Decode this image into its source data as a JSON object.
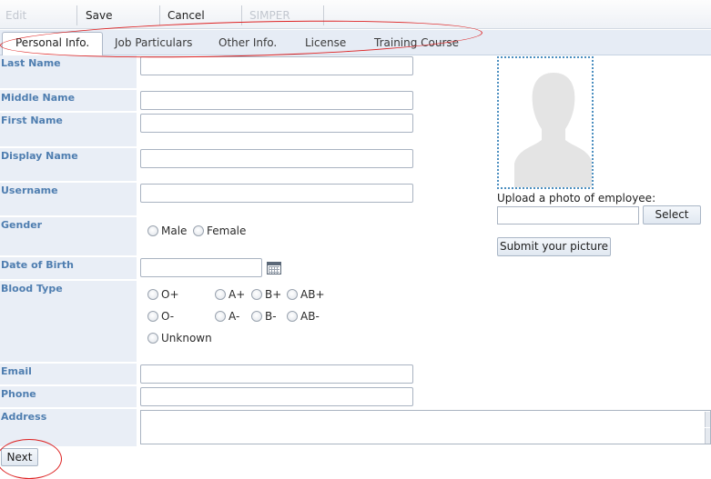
{
  "toolbar": {
    "edit_label": "Edit",
    "save_label": "Save",
    "cancel_label": "Cancel",
    "simper_label": "SIMPER"
  },
  "tabs": [
    {
      "label": "Personal Info.",
      "active": true
    },
    {
      "label": "Job Particulars",
      "active": false
    },
    {
      "label": "Other Info.",
      "active": false
    },
    {
      "label": "License",
      "active": false
    },
    {
      "label": "Training Course",
      "active": false
    }
  ],
  "form": {
    "last_name": {
      "label": "Last Name",
      "value": ""
    },
    "middle_name": {
      "label": "Middle Name",
      "value": ""
    },
    "first_name": {
      "label": "First Name",
      "value": ""
    },
    "display_name": {
      "label": "Display Name",
      "value": ""
    },
    "username": {
      "label": "Username",
      "value": ""
    },
    "gender": {
      "label": "Gender",
      "options": [
        "Male",
        "Female"
      ],
      "selected": null
    },
    "date_of_birth": {
      "label": "Date of Birth",
      "value": ""
    },
    "blood_type": {
      "label": "Blood Type",
      "options": [
        "O+",
        "A+",
        "B+",
        "AB+",
        "O-",
        "A-",
        "B-",
        "AB-",
        "Unknown"
      ],
      "selected": null
    },
    "email": {
      "label": "Email",
      "value": ""
    },
    "phone": {
      "label": "Phone",
      "value": ""
    },
    "address": {
      "label": "Address",
      "value": ""
    }
  },
  "photo": {
    "upload_label": "Upload a photo of employee:",
    "select_label": "Select",
    "submit_label": "Submit your picture"
  },
  "footer": {
    "next_label": "Next"
  },
  "colors": {
    "label_blue": "#4f7eb0",
    "label_bg": "#e9eef6",
    "annotation_red": "#dd2222",
    "photo_border": "#4c8fc0"
  }
}
